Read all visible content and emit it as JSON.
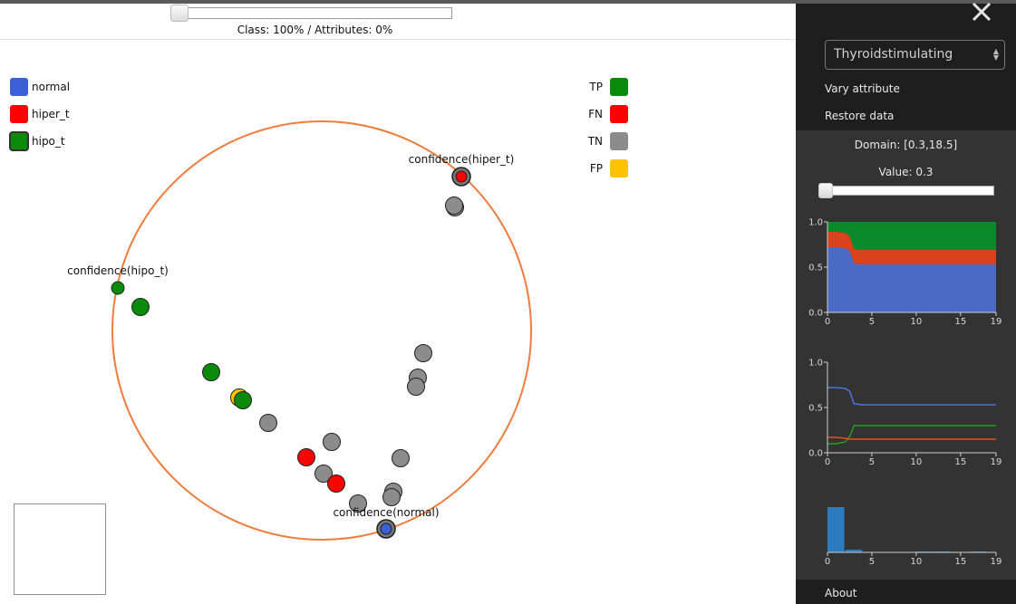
{
  "class_slider": {
    "value_fraction": 0.0,
    "label": "Class: 100% / Attributes: 0%"
  },
  "legend_classes": [
    {
      "label": "normal",
      "color": "#3b5fd6"
    },
    {
      "label": "hiper_t",
      "color": "#ff0000"
    },
    {
      "label": "hipo_t",
      "color": "#0a8a0a"
    }
  ],
  "legend_outcomes": [
    {
      "label": "TP",
      "color": "#0a8a0a"
    },
    {
      "label": "FN",
      "color": "#ff0000"
    },
    {
      "label": "TN",
      "color": "#8c8c8c"
    },
    {
      "label": "FP",
      "color": "#ffc200"
    }
  ],
  "anchors": {
    "hiper": "confidence(hiper_t)",
    "hipo": "confidence(hipo_t)",
    "normal": "confidence(normal)"
  },
  "sidebar": {
    "close_icon": "close-icon",
    "attribute_select": "Thyroidstimulating",
    "vary_attribute": "Vary attribute",
    "restore_data": "Restore data",
    "domain_text": "Domain: [0.3,18.5]",
    "value_text": "Value: 0.3",
    "value_slider_fraction": 0.0,
    "about": "About"
  },
  "chart_data": [
    {
      "type": "area",
      "x": [
        0,
        1,
        2,
        2.5,
        3,
        4,
        5,
        10,
        15,
        19
      ],
      "xlim": [
        0,
        19
      ],
      "ylim": [
        0,
        1
      ],
      "xticks": [
        "0",
        "5",
        "10",
        "15",
        "19"
      ],
      "yticks": [
        "0.0",
        "0.5",
        "1.0"
      ],
      "series": [
        {
          "values": [
            0.72,
            0.72,
            0.71,
            0.68,
            0.54,
            0.53,
            0.53,
            0.53,
            0.53,
            0.53
          ],
          "color": "#4b6ac4"
        },
        {
          "values": [
            0.17,
            0.17,
            0.17,
            0.16,
            0.16,
            0.16,
            0.16,
            0.16,
            0.16,
            0.16
          ],
          "color": "#d8431e"
        },
        {
          "values": [
            0.11,
            0.11,
            0.12,
            0.16,
            0.3,
            0.31,
            0.31,
            0.31,
            0.31,
            0.31
          ],
          "color": "#0a8a2a"
        }
      ]
    },
    {
      "type": "line",
      "x": [
        0,
        1,
        2,
        2.5,
        3,
        4,
        5,
        10,
        15,
        19
      ],
      "xlim": [
        0,
        19
      ],
      "ylim": [
        0,
        1
      ],
      "xticks": [
        "0",
        "5",
        "10",
        "15",
        "19"
      ],
      "yticks": [
        "0.0",
        "0.5",
        "1.0"
      ],
      "series": [
        {
          "values": [
            0.72,
            0.72,
            0.71,
            0.68,
            0.54,
            0.53,
            0.53,
            0.53,
            0.53,
            0.53
          ],
          "color": "#4b74e0"
        },
        {
          "values": [
            0.1,
            0.1,
            0.12,
            0.18,
            0.3,
            0.3,
            0.3,
            0.3,
            0.3,
            0.3
          ],
          "color": "#1ea31e"
        },
        {
          "values": [
            0.17,
            0.17,
            0.16,
            0.15,
            0.15,
            0.15,
            0.15,
            0.15,
            0.15,
            0.15
          ],
          "color": "#e8501e"
        }
      ]
    },
    {
      "type": "bar",
      "bin_edges": [
        0,
        2,
        4,
        6,
        8,
        10,
        12,
        14,
        16,
        18
      ],
      "values": [
        1.0,
        0.06,
        0.0,
        0.0,
        0.0,
        0.02,
        0.02,
        0.0,
        0.02
      ],
      "xlim": [
        0,
        19
      ],
      "xticks": [
        "0",
        "5",
        "10",
        "15",
        "19"
      ],
      "color": "#2a7bc0"
    }
  ],
  "scatter": {
    "circle": {
      "color": "#f07c3e"
    },
    "points": [
      {
        "cx": 509,
        "cy": 187,
        "class": "hiper_t",
        "fill": "#ff0000",
        "anchor": true
      },
      {
        "cx": 130,
        "cy": 310,
        "class": "hipo_t",
        "fill": "#0a8a0a",
        "anchor": true,
        "small": true
      },
      {
        "cx": 426,
        "cy": 576,
        "class": "normal",
        "fill": "#3b5fd6",
        "anchor": true
      },
      {
        "cx": 502,
        "cy": 221,
        "fill": "#8c8c8c"
      },
      {
        "cx": 501,
        "cy": 219,
        "fill": "#8c8c8c"
      },
      {
        "cx": 155,
        "cy": 331,
        "fill": "#0a8a0a"
      },
      {
        "cx": 233,
        "cy": 403,
        "fill": "#0a8a0a"
      },
      {
        "cx": 264,
        "cy": 431,
        "fill": "#ffc200"
      },
      {
        "cx": 268,
        "cy": 434,
        "fill": "#0a8a0a"
      },
      {
        "cx": 296,
        "cy": 459,
        "fill": "#8c8c8c"
      },
      {
        "cx": 467,
        "cy": 382,
        "fill": "#8c8c8c"
      },
      {
        "cx": 461,
        "cy": 409,
        "fill": "#8c8c8c"
      },
      {
        "cx": 459,
        "cy": 419,
        "fill": "#8c8c8c"
      },
      {
        "cx": 366,
        "cy": 480,
        "fill": "#8c8c8c"
      },
      {
        "cx": 442,
        "cy": 498,
        "fill": "#8c8c8c"
      },
      {
        "cx": 338,
        "cy": 497,
        "fill": "#ff0000"
      },
      {
        "cx": 357,
        "cy": 515,
        "fill": "#8c8c8c"
      },
      {
        "cx": 371,
        "cy": 526,
        "fill": "#ff0000"
      },
      {
        "cx": 434,
        "cy": 535,
        "fill": "#8c8c8c"
      },
      {
        "cx": 432,
        "cy": 541,
        "fill": "#8c8c8c"
      },
      {
        "cx": 395,
        "cy": 548,
        "fill": "#8c8c8c"
      }
    ]
  }
}
